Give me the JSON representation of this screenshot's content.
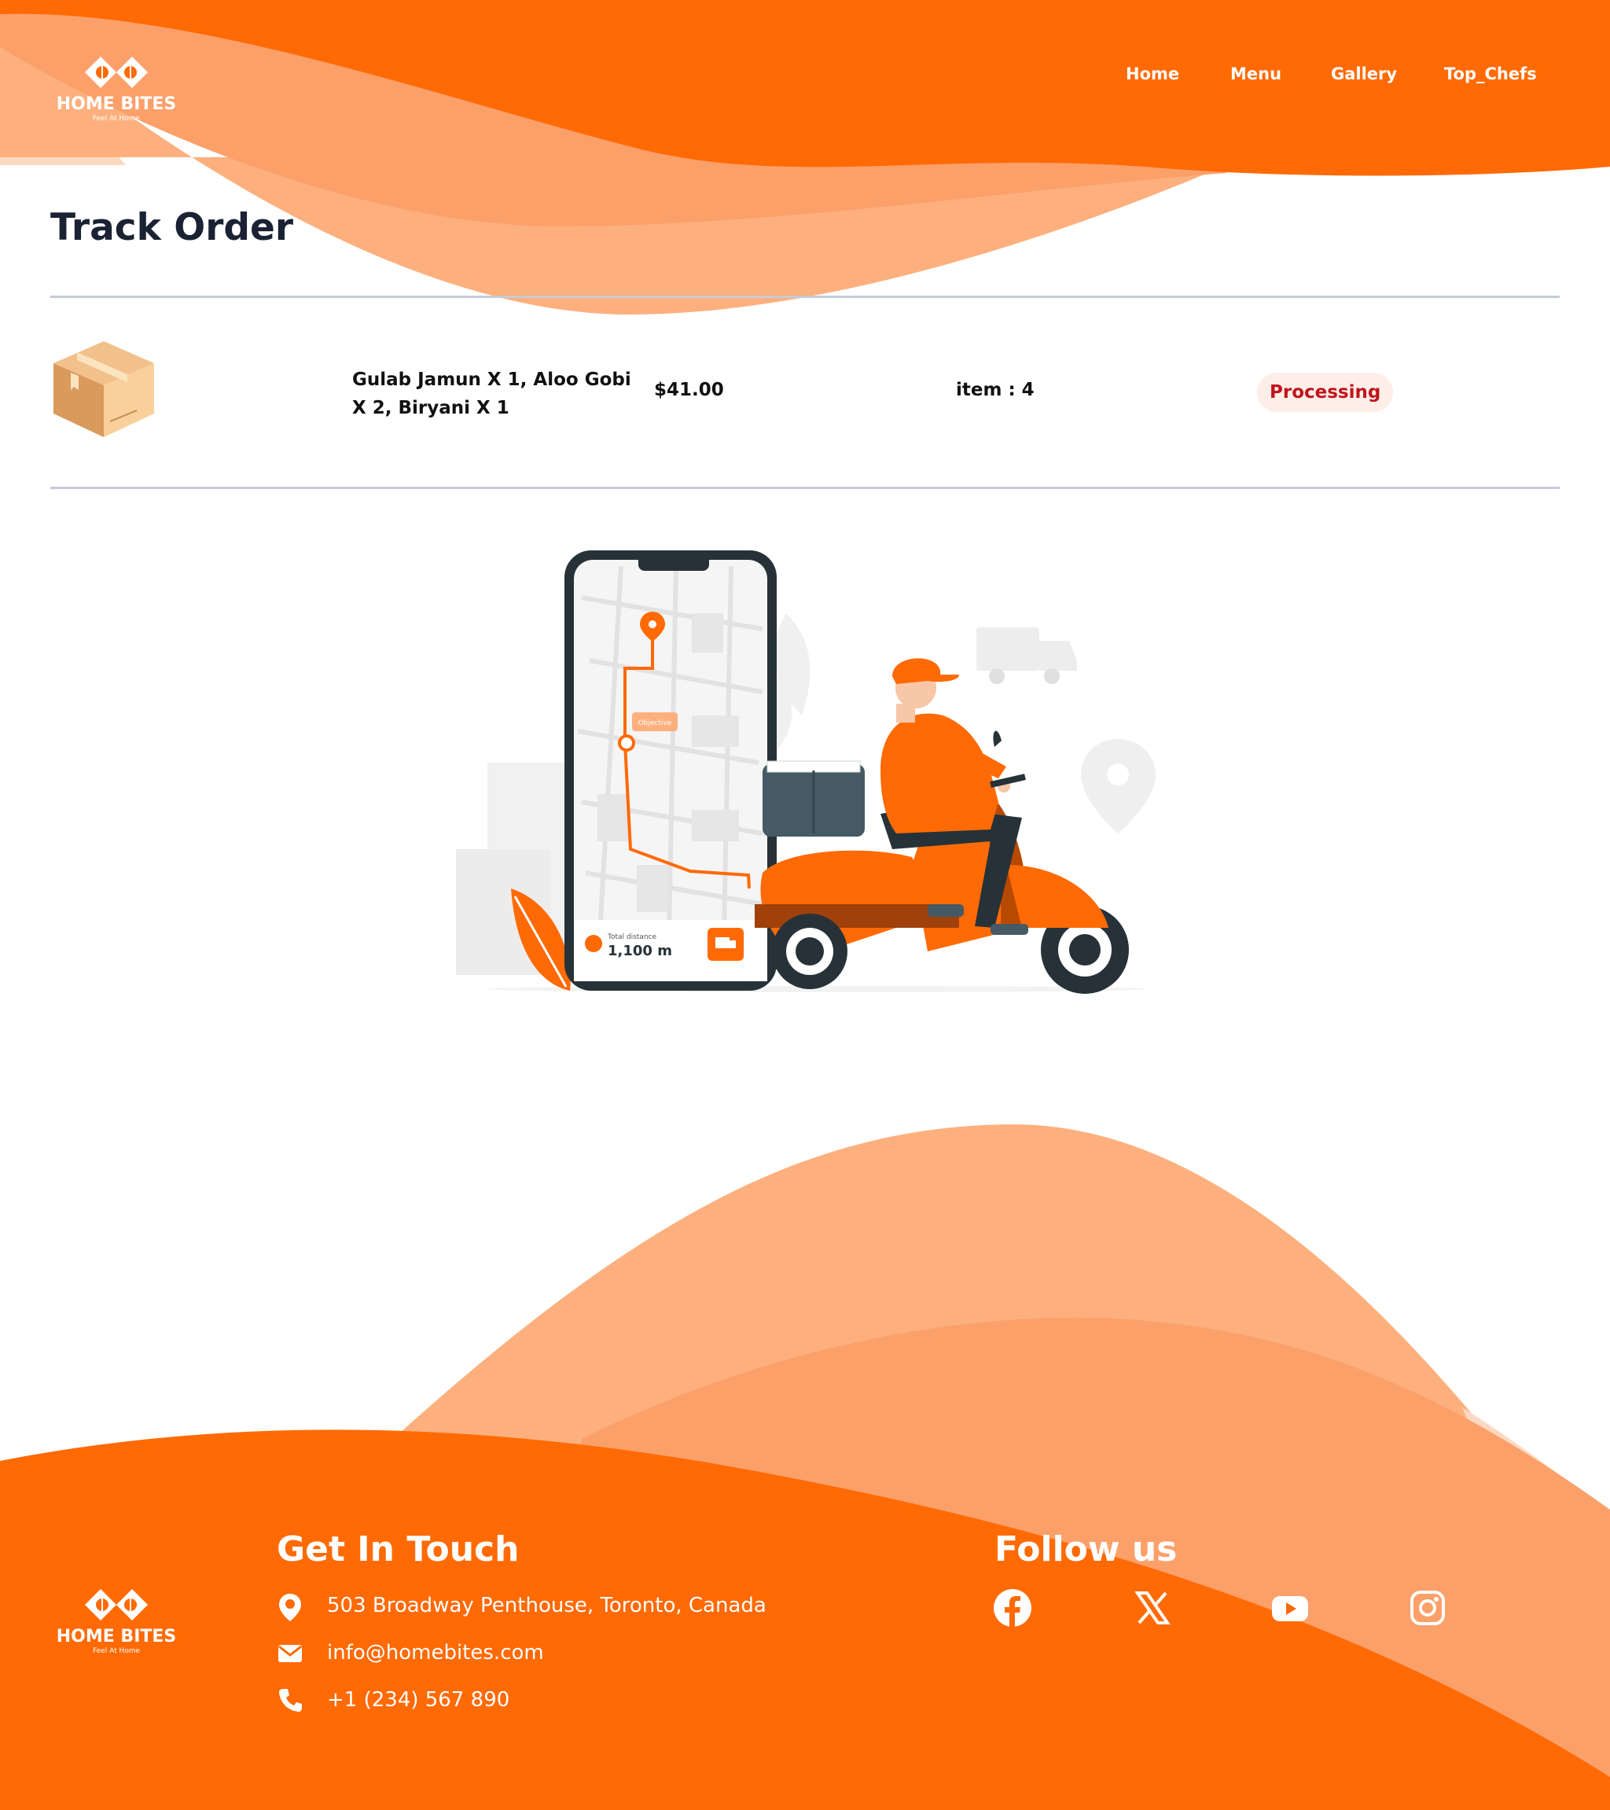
{
  "brand": {
    "name": "HOME BITES",
    "tagline": "Feel At Home"
  },
  "nav": {
    "items": [
      {
        "label": "Home"
      },
      {
        "label": "Menu"
      },
      {
        "label": "Gallery"
      },
      {
        "label": "Top_Chefs"
      }
    ]
  },
  "page": {
    "title": "Track Order"
  },
  "order": {
    "items_text": "Gulab Jamun X 1, Aloo Gobi X 2, Biryani X 1",
    "price": "$41.00",
    "count": "item : 4",
    "status": "Processing"
  },
  "illustration": {
    "map_label": "Objective",
    "distance_label": "Total distance",
    "distance_value": "1,100 m"
  },
  "footer": {
    "contact_heading": "Get In Touch",
    "address": "503 Broadway Penthouse, Toronto, Canada",
    "email": "info@homebites.com",
    "phone": "+1 (234) 567 890",
    "follow_heading": "Follow us",
    "social": [
      "facebook-icon",
      "x-icon",
      "youtube-icon",
      "instagram-icon"
    ]
  },
  "colors": {
    "primary_orange": "#ff6a05",
    "light_orange": "#fdb07e",
    "mid_orange": "#fca06a",
    "pale_orange": "#fed9c2",
    "title_text": "#1a2233",
    "status_text": "#c0141c",
    "status_bg": "#fdeee8",
    "divider": "#c5cbd8"
  }
}
